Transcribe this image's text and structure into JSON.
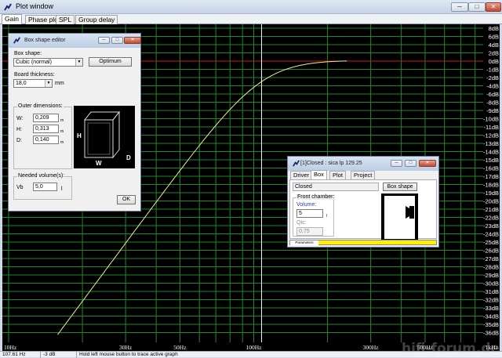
{
  "window": {
    "title": "Plot window",
    "min_btn": "─",
    "max_btn": "□",
    "close_btn": "✕"
  },
  "tabs": [
    "Gain",
    "Phase plot",
    "SPL",
    "Group delay"
  ],
  "plot": {
    "db_labels": [
      "8dB",
      "6dB",
      "4dB",
      "2dB",
      "0dB",
      "-1dB",
      "-2dB",
      "-4dB",
      "-6dB",
      "-8dB",
      "-9dB",
      "-10dB",
      "-11dB",
      "-12dB",
      "-13dB",
      "-14dB",
      "-15dB",
      "-16dB",
      "-17dB",
      "-18dB",
      "-19dB",
      "-20dB",
      "-21dB",
      "-22dB",
      "-23dB",
      "-24dB",
      "-25dB",
      "-26dB",
      "-27dB",
      "-28dB",
      "-29dB",
      "-30dB",
      "-31dB",
      "-32dB",
      "-33dB",
      "-34dB",
      "-35dB",
      "-36dB"
    ],
    "freq_labels": [
      "10Hz",
      "30Hz",
      "50Hz",
      "100Hz",
      "300Hz",
      "500Hz",
      "1kHz"
    ],
    "colors": {
      "grid": "#1e8a2a",
      "curve": "#f2eb92",
      "ref": "#c21e1e",
      "bg": "#000000",
      "marker": "#ffffff"
    }
  },
  "status": {
    "freq": "107.61 Hz",
    "level": "-3 dB",
    "hint": "Hold left mouse button to trace active graph"
  },
  "box_editor": {
    "title": "Box shape editor",
    "box_shape_label": "Box shape:",
    "box_shape_value": "Cubic (normal)",
    "optimum_btn": "Optimum",
    "board_label": "Board thickness:",
    "board_value": "18,0",
    "board_unit": "mm",
    "outer_group": "Outer dimensions:",
    "w_label": "W:",
    "w_value": "0,209",
    "h_label": "H:",
    "h_value": "0,313",
    "d_label": "D:",
    "d_value": "0,140",
    "dim_unit": "m",
    "diagram": {
      "h": "H",
      "w": "W",
      "d": "D"
    },
    "needed_group": "Needed volume(s):",
    "vb_label": "Vb",
    "vb_value": "5,0",
    "vb_unit": "l",
    "ok_btn": "OK"
  },
  "closed_dlg": {
    "title": "[1]Closed : sica lp 129.25",
    "tabs": [
      "Driver",
      "Box",
      "Plot",
      "Project"
    ],
    "type_value": "Closed",
    "box_shape_btn": "Box shape",
    "front_group": "Front chamber:",
    "volume_label": "Volume:",
    "volume_value": "5",
    "volume_unit": "l",
    "qtc_label": "Qtc:",
    "qtc_value": "0,75",
    "params_label": "Parameters"
  },
  "watermark": "hifi-forum.de"
}
